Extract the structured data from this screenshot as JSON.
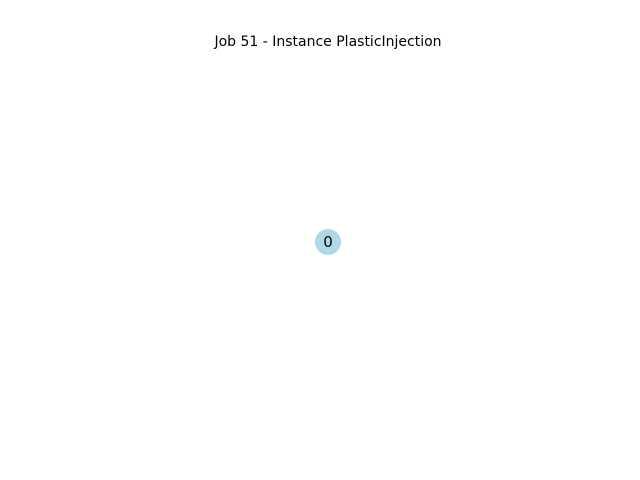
{
  "title": "Job 51 - Instance PlasticInjection",
  "graph": {
    "nodes": [
      {
        "label": "0",
        "color": "#ADD8E6"
      }
    ],
    "edges": []
  }
}
